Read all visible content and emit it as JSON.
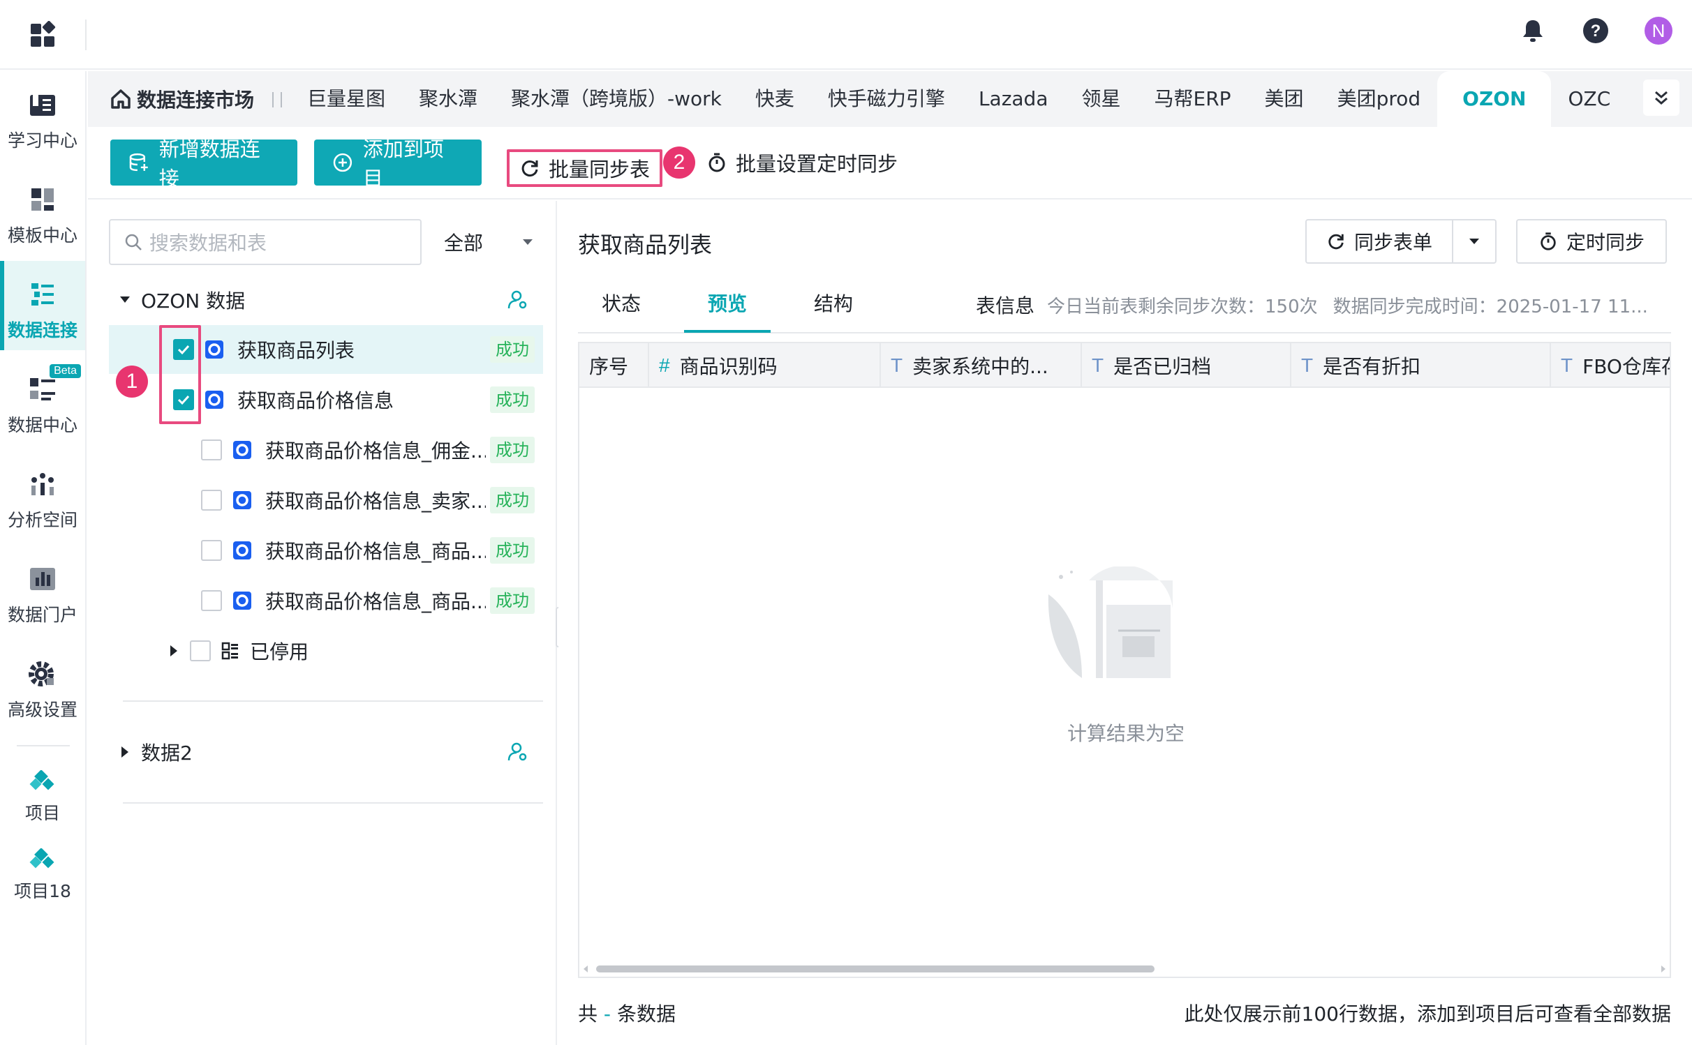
{
  "header": {
    "icons": [
      "apps-grid-icon",
      "bell-icon",
      "help-icon"
    ],
    "avatar_letter": "N"
  },
  "sidebar": {
    "items": [
      {
        "label": "学习中心",
        "icon": "book-icon"
      },
      {
        "label": "模板中心",
        "icon": "template-icon"
      },
      {
        "label": "数据连接",
        "icon": "data-connect-icon",
        "active": true
      },
      {
        "label": "数据中心",
        "icon": "data-center-icon",
        "badge": "Beta"
      },
      {
        "label": "分析空间",
        "icon": "analysis-icon"
      },
      {
        "label": "数据门户",
        "icon": "portal-icon"
      },
      {
        "label": "高级设置",
        "icon": "gear-icon"
      },
      {
        "label": "项目",
        "icon": "project-icon"
      },
      {
        "label": "项目18",
        "icon": "project-icon"
      }
    ]
  },
  "tabs": {
    "home": "数据连接市场",
    "items": [
      "巨量星图",
      "聚水潭",
      "聚水潭（跨境版）-work",
      "快麦",
      "快手磁力引擎",
      "Lazada",
      "领星",
      "马帮ERP",
      "美团",
      "美团prod",
      "OZON",
      "OZC"
    ],
    "active": "OZON"
  },
  "toolbar": {
    "new_connection": "新增数据连接",
    "add_to_project": "添加到项目",
    "batch_sync": "批量同步表",
    "batch_schedule": "批量设置定时同步",
    "marker_1": "1",
    "marker_2": "2"
  },
  "tree": {
    "search_placeholder": "搜索数据和表",
    "filter": "全部",
    "group1": "OZON 数据",
    "rows": [
      {
        "label": "获取商品列表",
        "status": "成功",
        "checked": true
      },
      {
        "label": "获取商品价格信息",
        "status": "成功",
        "checked": true
      },
      {
        "label": "获取商品价格信息_佣金...",
        "status": "成功",
        "checked": false
      },
      {
        "label": "获取商品价格信息_卖家...",
        "status": "成功",
        "checked": false
      },
      {
        "label": "获取商品价格信息_商品...",
        "status": "成功",
        "checked": false
      },
      {
        "label": "获取商品价格信息_商品...",
        "status": "成功",
        "checked": false
      }
    ],
    "disabled_folder": "已停用",
    "group2": "数据2"
  },
  "detail": {
    "title": "获取商品列表",
    "sync_button": "同步表单",
    "timer_button": "定时同步",
    "tabs": [
      "状态",
      "预览",
      "结构"
    ],
    "active_tab": "预览",
    "info_label": "表信息",
    "remaining": "今日当前表剩余同步次数：150次",
    "completed": "数据同步完成时间：2025-01-17 11...",
    "columns": [
      {
        "type": "",
        "name": "序号"
      },
      {
        "type": "#",
        "name": "商品识别码"
      },
      {
        "type": "T",
        "name": "卖家系统中的..."
      },
      {
        "type": "T",
        "name": "是否已归档"
      },
      {
        "type": "T",
        "name": "是否有折扣"
      },
      {
        "type": "T",
        "name": "FBO仓库存"
      }
    ],
    "empty_text": "计算结果为空",
    "footer_prefix": "共",
    "footer_count": "-",
    "footer_suffix": "条数据",
    "footer_note": "此处仅展示前100行数据，添加到项目后可查看全部数据"
  }
}
